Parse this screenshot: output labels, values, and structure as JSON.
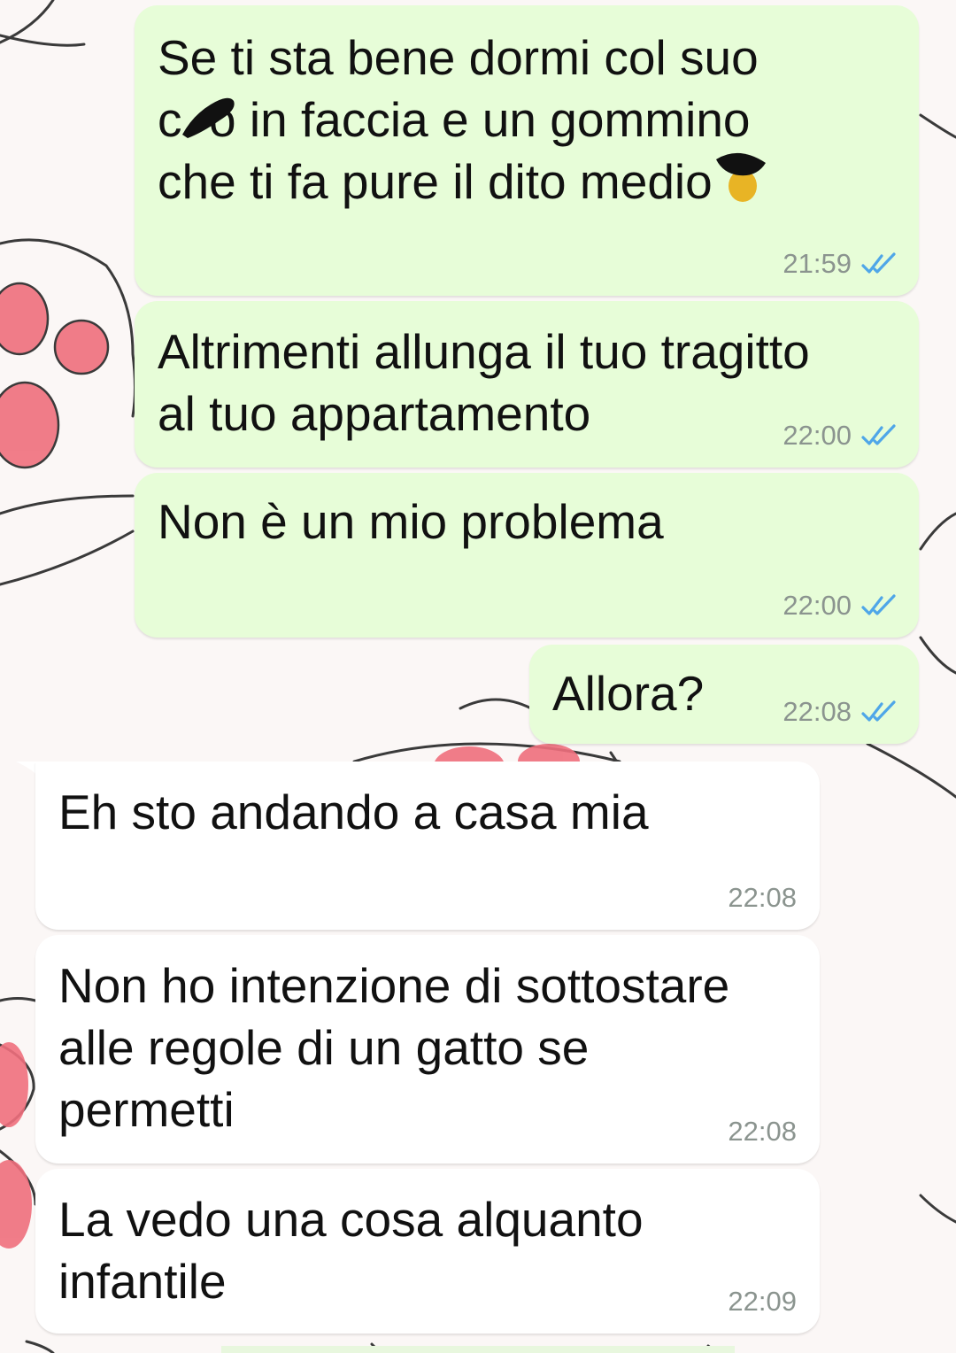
{
  "conversation": {
    "messages": [
      {
        "direction": "outgoing",
        "text": "Se ti sta bene dormi col suo\nc  o in faccia e un gommino\nche ti fa pure il dito medio",
        "time": "21:59",
        "status": "read",
        "emoji": "middle-finger-emoji"
      },
      {
        "direction": "outgoing",
        "text": "Altrimenti allunga il tuo tragitto\nal tuo appartamento",
        "time": "22:00",
        "status": "read"
      },
      {
        "direction": "outgoing",
        "text": "Non è un mio problema",
        "time": "22:00",
        "status": "read"
      },
      {
        "direction": "outgoing",
        "text": "Allora?",
        "time": "22:08",
        "status": "read"
      },
      {
        "direction": "incoming",
        "text": "Eh sto andando a casa mia",
        "time": "22:08"
      },
      {
        "direction": "incoming",
        "text": "Non ho intenzione di sottostare\nalle regole di un gatto se\npermetti",
        "time": "22:08"
      },
      {
        "direction": "incoming",
        "text": "La vedo una cosa alquanto\ninfantile",
        "time": "22:09"
      }
    ]
  },
  "colors": {
    "outgoing_bubble": "#e7fdd8",
    "incoming_bubble": "#ffffff",
    "read_ticks": "#4fa6e8",
    "timestamp": "#8b948f",
    "wallpaper": "#fbf7f6",
    "paw_pad": "#ef6f7d"
  },
  "icons": {
    "read_status": "double-check-icon",
    "wallpaper": "cat-paw-wallpaper"
  }
}
